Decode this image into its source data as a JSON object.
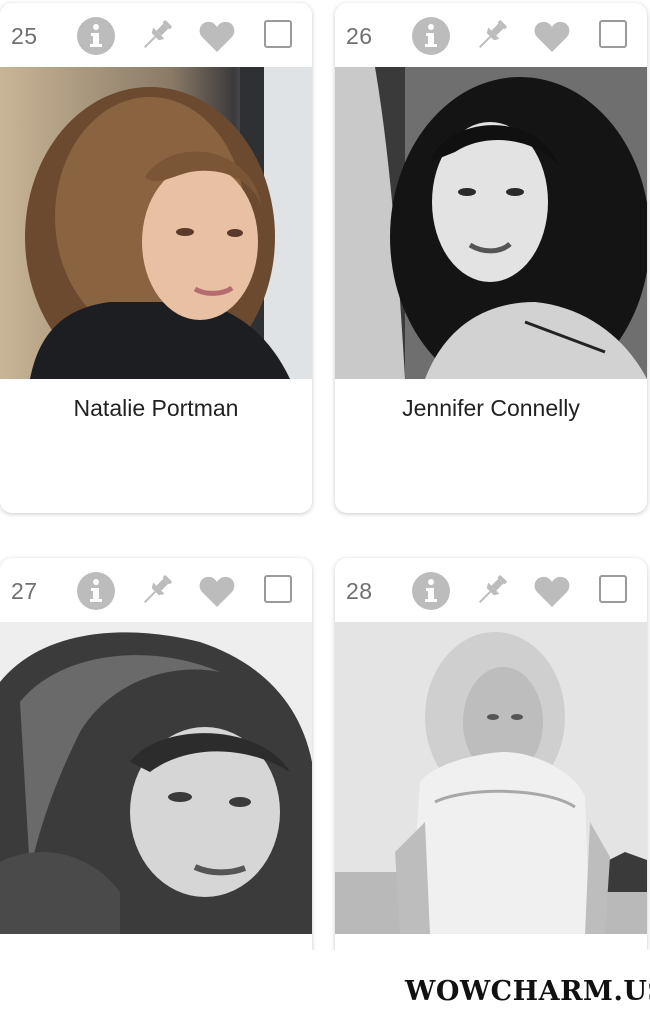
{
  "cards": [
    {
      "rank": "25",
      "name": "Natalie Portman"
    },
    {
      "rank": "26",
      "name": "Jennifer Connelly"
    },
    {
      "rank": "27",
      "name": ""
    },
    {
      "rank": "28",
      "name": ""
    }
  ],
  "icons": {
    "info": "info-icon",
    "pin": "pin-icon",
    "heart": "heart-icon",
    "checkbox": "checkbox"
  },
  "watermark": "WOWCHARM.US",
  "colors": {
    "icon_gray": "#bcbcbc",
    "rank_gray": "#707070",
    "name_text": "#222222"
  }
}
